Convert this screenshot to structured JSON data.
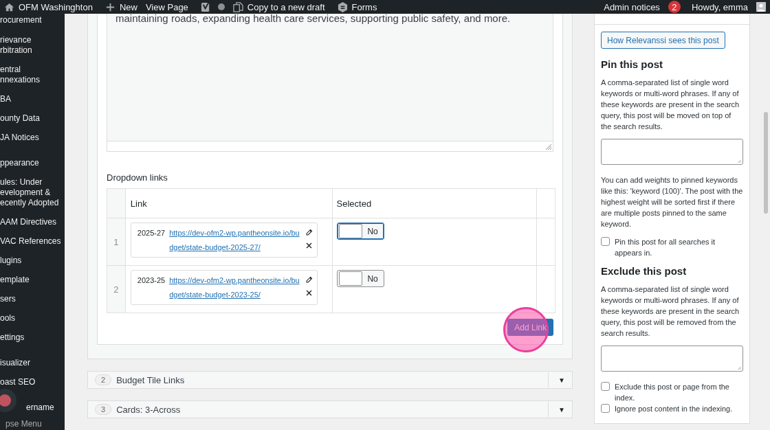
{
  "admin_bar": {
    "site": "OFM Washinghton",
    "new": "New",
    "view": "View Page",
    "copy": "Copy to a new draft",
    "forms": "Forms",
    "notices": "Admin notices",
    "notice_count": "2",
    "howdy": "Howdy, emma"
  },
  "sidebar": {
    "groups": [
      [
        {
          "lines": [
            "rocurement"
          ]
        },
        {
          "lines": [
            "rievance",
            "rbitration"
          ]
        },
        {
          "lines": [
            "entral",
            "nnexations"
          ]
        },
        {
          "lines": [
            "BA"
          ]
        },
        {
          "lines": [
            "ounty Data"
          ]
        },
        {
          "lines": [
            "JA Notices"
          ]
        }
      ],
      [
        {
          "lines": [
            "ppearance"
          ]
        },
        {
          "lines": [
            "ules: Under",
            "evelopment &",
            "ecently Adopted"
          ]
        },
        {
          "lines": [
            "AAM Directives"
          ]
        },
        {
          "lines": [
            "VAC References"
          ]
        },
        {
          "lines": [
            "lugins"
          ]
        },
        {
          "lines": [
            "emplate"
          ]
        },
        {
          "lines": [
            "sers"
          ]
        },
        {
          "lines": [
            "ools"
          ]
        },
        {
          "lines": [
            "ettings"
          ]
        }
      ],
      [
        {
          "lines": [
            "isualizer"
          ]
        },
        {
          "lines": [
            "oast SEO"
          ]
        }
      ]
    ],
    "account": "ername",
    "collapse": "pse Menu"
  },
  "editor": {
    "text": "maintaining roads, expanding health care services, supporting public safety, and more."
  },
  "dropdown": {
    "label": "Dropdown links",
    "columns": [
      "Link",
      "Selected"
    ],
    "rows": [
      {
        "num": "1",
        "year": "2025-27",
        "url": "https://dev-ofm2-wp.pantheonsite.io/budget/state-budget-2025-27/",
        "on": false,
        "focused": true,
        "toggle": "No"
      },
      {
        "num": "2",
        "year": "2023-25",
        "url": "https://dev-ofm2-wp.pantheonsite.io/budget/state-budget-2023-25/",
        "on": false,
        "focused": false,
        "toggle": "No"
      }
    ],
    "add": "Add Link"
  },
  "layouts": [
    {
      "num": "2",
      "title": "Budget Tile Links",
      "expand": "▼"
    },
    {
      "num": "3",
      "title": "Cards: 3-Across",
      "expand": "▼"
    }
  ],
  "relevanssi": {
    "button": "How Relevanssi sees this post",
    "pin_heading": "Pin this post",
    "pin_text": "A comma-separated list of single word keywords or multi-word phrases. If any of these keywords are present in the search query, this post will be moved on top of the search results.",
    "weights_text": "You can add weights to pinned keywords like this: 'keyword (100)'. The post with the highest weight will be sorted first if there are multiple posts pinned to the same keyword.",
    "pin_all": {
      "label": "Pin this post for all searches it appears in.",
      "checked": false
    },
    "exclude_heading": "Exclude this post",
    "exclude_text": "A comma-separated list of single word keywords or multi-word phrases. If any of these keywords are present in the search query, this post will be removed from the search results.",
    "checks": [
      {
        "label": "Exclude this post or page from the index.",
        "checked": false
      },
      {
        "label": "Ignore post content in the indexing.",
        "checked": false
      }
    ]
  }
}
